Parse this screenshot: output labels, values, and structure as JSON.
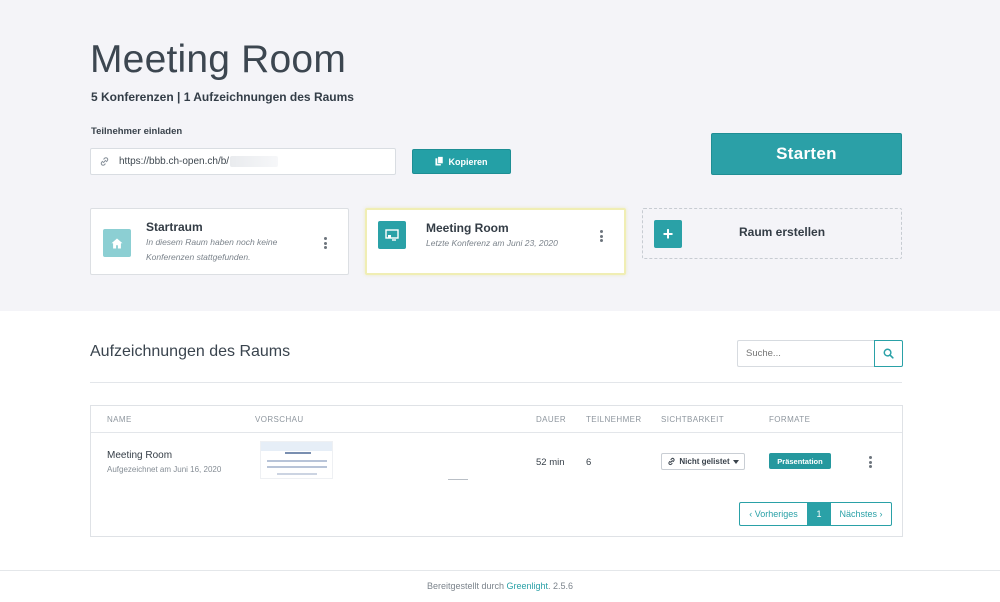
{
  "header": {
    "title": "Meeting Room",
    "subtitle": "5 Konferenzen | 1 Aufzeichnungen des Raums",
    "invite_label": "Teilnehmer einladen",
    "invite_url": "https://bbb.ch-open.ch/b/",
    "copy_label": "Kopieren",
    "start_label": "Starten"
  },
  "rooms": [
    {
      "name": "Startraum",
      "desc_line1": "In diesem Raum haben noch keine",
      "desc_line2": "Konferenzen stattgefunden.",
      "icon": "home-icon"
    },
    {
      "name": "Meeting Room",
      "desc_line1": "Letzte Konferenz am Juni 23, 2020",
      "icon": "presentation-icon"
    },
    {
      "name": "Raum erstellen",
      "icon": "plus-icon"
    }
  ],
  "recordings": {
    "title": "Aufzeichnungen des Raums",
    "search_placeholder": "Suche...",
    "columns": [
      "NAME",
      "VORSCHAU",
      "DAUER",
      "TEILNEHMER",
      "SICHTBARKEIT",
      "FORMATE"
    ],
    "rows": [
      {
        "name": "Meeting Room",
        "recorded": "Aufgezeichnet am Juni 16, 2020",
        "duration": "52 min",
        "participants": "6",
        "visibility": "Nicht gelistet",
        "format": "Präsentation"
      }
    ],
    "pagination": {
      "prev": "‹ Vorheriges",
      "current": "1",
      "next": "Nächstes ›"
    }
  },
  "footer": {
    "prefix": "Bereitgestellt durch",
    "link": "Greenlight",
    "version": ". 2.5.6"
  },
  "colors": {
    "accent": "#2aa1a7",
    "background": "#f4f4f8",
    "highlight_border": "#f0eeb4"
  }
}
